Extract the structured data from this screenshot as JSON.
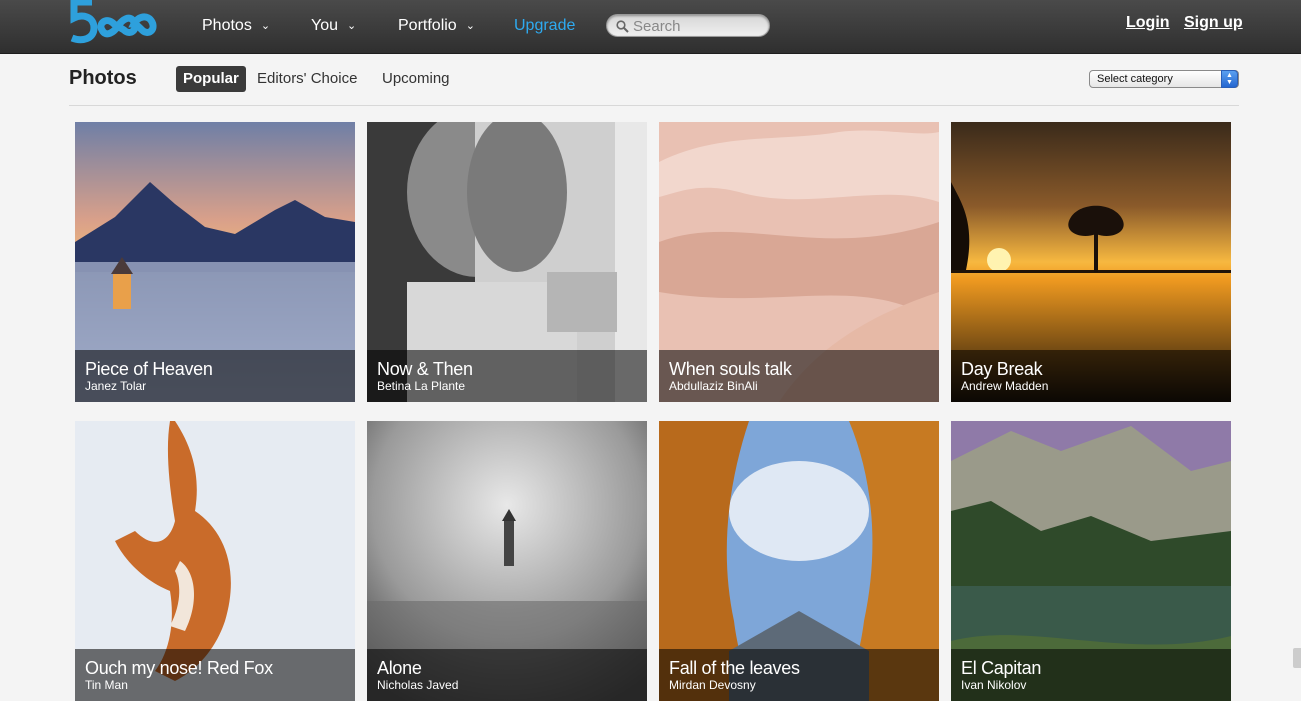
{
  "nav": {
    "logo_text": "500",
    "items": [
      {
        "label": "Photos"
      },
      {
        "label": "You"
      },
      {
        "label": "Portfolio"
      }
    ],
    "upgrade": "Upgrade",
    "search_placeholder": "Search",
    "login": "Login",
    "signup": "Sign up"
  },
  "subheader": {
    "title": "Photos",
    "tabs": [
      {
        "label": "Popular",
        "active": true
      },
      {
        "label": "Editors' Choice"
      },
      {
        "label": "Upcoming"
      }
    ],
    "category_select": "Select category"
  },
  "photos": [
    {
      "title": "Piece of Heaven",
      "author": "Janez Tolar"
    },
    {
      "title": "Now & Then",
      "author": "Betina La Plante"
    },
    {
      "title": "When souls talk",
      "author": "Abdullaziz BinAli"
    },
    {
      "title": "Day Break",
      "author": "Andrew Madden"
    },
    {
      "title": "Ouch my nose! Red Fox",
      "author": "Tin Man"
    },
    {
      "title": "Alone",
      "author": "Nicholas Javed"
    },
    {
      "title": "Fall of the leaves",
      "author": "Mirdan Devosny"
    },
    {
      "title": "El Capitan",
      "author": "Ivan Nikolov"
    }
  ],
  "colors": {
    "accent": "#2eaaf0",
    "nav_bg": "#3a3a3a"
  }
}
